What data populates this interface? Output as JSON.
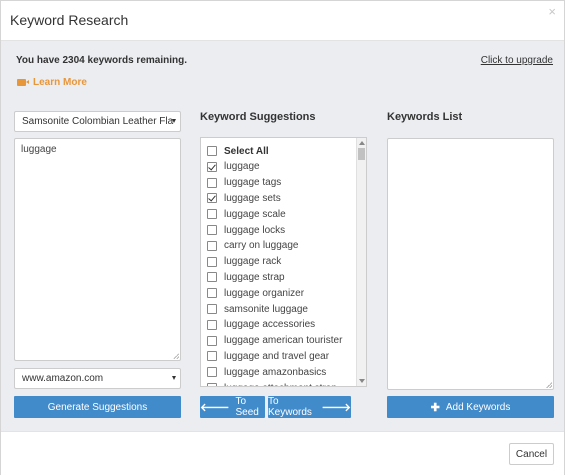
{
  "header": {
    "title": "Keyword Research",
    "close_symbol": "×"
  },
  "info": {
    "remaining": "You have 2304 keywords remaining.",
    "upgrade_link": "Click to upgrade",
    "learn_more": "Learn More"
  },
  "left": {
    "product_select": "Samsonite Colombian Leather Fla",
    "seed_text": "luggage",
    "marketplace_select": "www.amazon.com",
    "generate_button": "Generate Suggestions"
  },
  "middle": {
    "title": "Keyword Suggestions",
    "items": [
      {
        "label": "Select All",
        "checked": false,
        "bold": true
      },
      {
        "label": "luggage",
        "checked": true,
        "bold": false
      },
      {
        "label": "luggage tags",
        "checked": false,
        "bold": false
      },
      {
        "label": "luggage sets",
        "checked": true,
        "bold": false
      },
      {
        "label": "luggage scale",
        "checked": false,
        "bold": false
      },
      {
        "label": "luggage locks",
        "checked": false,
        "bold": false
      },
      {
        "label": "carry on luggage",
        "checked": false,
        "bold": false
      },
      {
        "label": "luggage rack",
        "checked": false,
        "bold": false
      },
      {
        "label": "luggage strap",
        "checked": false,
        "bold": false
      },
      {
        "label": "luggage organizer",
        "checked": false,
        "bold": false
      },
      {
        "label": "samsonite luggage",
        "checked": false,
        "bold": false
      },
      {
        "label": "luggage accessories",
        "checked": false,
        "bold": false
      },
      {
        "label": "luggage american tourister",
        "checked": false,
        "bold": false
      },
      {
        "label": "luggage and travel gear",
        "checked": false,
        "bold": false
      },
      {
        "label": "luggage amazonbasics",
        "checked": false,
        "bold": false
      },
      {
        "label": "luggage attachment strap",
        "checked": false,
        "bold": false
      }
    ],
    "to_seed_button": "To Seed",
    "to_keywords_button": "To Keywords"
  },
  "right": {
    "title": "Keywords List",
    "list_text": "",
    "add_button": "Add Keywords"
  },
  "footer": {
    "cancel_button": "Cancel"
  },
  "colors": {
    "primary": "#428bca",
    "accent": "#e8963a",
    "panel_bg": "#ebedf1"
  }
}
